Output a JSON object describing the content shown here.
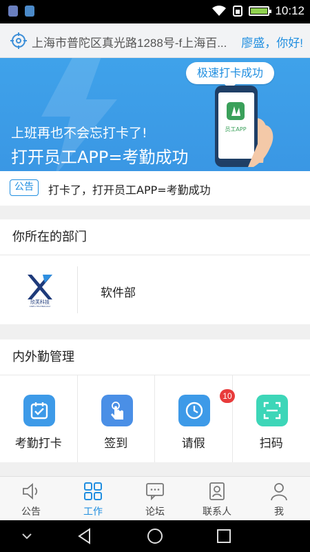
{
  "status_bar": {
    "time": "10:12",
    "battery_level": 1.0
  },
  "header": {
    "address": "上海市普陀区真光路1288号-f上海百...",
    "greeting": "廖盛，你好!"
  },
  "banner": {
    "bubble": "极速打卡成功",
    "phone_app_label": "员工APP",
    "line1": "上班再也不会忘打卡了!",
    "line2": "打开员工APP=考勤成功"
  },
  "notice": {
    "tag": "公告",
    "text": "打卡了，打开员工APP=考勤成功"
  },
  "department": {
    "title": "你所在的部门",
    "logo_text": "欣芙科技",
    "logo_subtext": "XINFU TECHNOLOGY",
    "name": "软件部"
  },
  "attendance": {
    "title": "内外勤管理",
    "items": [
      {
        "label": "考勤打卡",
        "icon": "calendar-check-icon",
        "color": "#3d9ae8"
      },
      {
        "label": "签到",
        "icon": "tap-hand-icon",
        "color": "#4a8fe6"
      },
      {
        "label": "请假",
        "icon": "clock-icon",
        "color": "#3d9ae8",
        "badge": "10"
      },
      {
        "label": "扫码",
        "icon": "scan-icon",
        "color": "#3dd6b8"
      }
    ]
  },
  "tabs": [
    {
      "label": "公告",
      "icon": "speaker-icon",
      "active": false
    },
    {
      "label": "工作",
      "icon": "grid-icon",
      "active": true
    },
    {
      "label": "论坛",
      "icon": "chat-icon",
      "active": false
    },
    {
      "label": "联系人",
      "icon": "contact-icon",
      "active": false
    },
    {
      "label": "我",
      "icon": "person-icon",
      "active": false
    }
  ],
  "colors": {
    "accent": "#1f8ee0",
    "banner": "#3a9de8",
    "badge": "#e83b3b"
  }
}
